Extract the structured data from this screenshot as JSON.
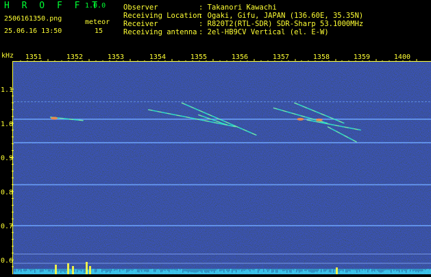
{
  "header": {
    "app_title": "H R O F F T",
    "version": "1.0.0",
    "filename": "2506161350.png",
    "datetime": "25.06.16 13:50",
    "meteor_label": "meteor",
    "meteor_count": "15",
    "fields": [
      {
        "label": "Observer",
        "value": ": Takanori Kawachi"
      },
      {
        "label": "Receiving Location",
        "value": ": Ogaki, Gifu, JAPAN (136.60E, 35.35N)"
      },
      {
        "label": "Receiver",
        "value": ": R820T2(RTL-SDR) SDR-Sharp 53.1000MHz"
      },
      {
        "label": "Receiving antenna",
        "value": ": 2el-HB9CV Vertical (el. E-W)"
      }
    ]
  },
  "colors": {
    "label_yellow": "#ffff33",
    "label_green": "#00ff33",
    "background": "#000000",
    "noise_blue": "#1a2a8a"
  },
  "chart_data": {
    "type": "heatmap",
    "ylabel": "kHz",
    "y_ticks": [
      "1.1",
      "1.0",
      "0.9",
      "0.8",
      "0.7",
      "0.6"
    ],
    "y_tick_values": [
      1.1,
      1.0,
      0.9,
      0.8,
      0.7,
      0.6
    ],
    "x_ticks": [
      "1351",
      "1352",
      "1353",
      "1354",
      "1355",
      "1356",
      "1357",
      "1358",
      "1359",
      "1400"
    ],
    "x_tick_values": [
      1351,
      1352,
      1353,
      1354,
      1355,
      1356,
      1357,
      1358,
      1359,
      1400
    ],
    "ylim": [
      0.56,
      1.17
    ],
    "xlim": [
      1350.7,
      1400
    ],
    "carriers_khz": [
      1.063,
      1.012,
      0.943,
      0.82,
      0.7,
      0.617,
      0.59
    ],
    "meteor_streaks": [
      {
        "t0": 1351.05,
        "f0": 1.018,
        "t1": 1351.85,
        "f1": 1.008
      },
      {
        "t0": 1353.4,
        "f0": 1.04,
        "t1": 1355.5,
        "f1": 0.99
      },
      {
        "t0": 1354.2,
        "f0": 1.06,
        "t1": 1356.0,
        "f1": 0.965
      },
      {
        "t0": 1354.6,
        "f0": 1.025,
        "t1": 1355.3,
        "f1": 0.995
      },
      {
        "t0": 1356.4,
        "f0": 1.045,
        "t1": 1357.7,
        "f1": 1.0
      },
      {
        "t0": 1356.9,
        "f0": 1.06,
        "t1": 1358.1,
        "f1": 1.0
      },
      {
        "t0": 1357.2,
        "f0": 1.01,
        "t1": 1358.5,
        "f1": 0.98
      },
      {
        "t0": 1357.7,
        "f0": 0.99,
        "t1": 1358.4,
        "f1": 0.945
      }
    ]
  }
}
